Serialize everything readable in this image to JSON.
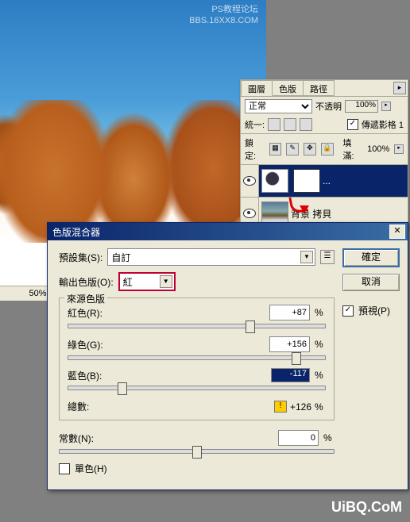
{
  "watermark": {
    "line1": "PS教程论坛",
    "line2": "BBS.16XX8.COM",
    "bottom": "UiBQ.CoM"
  },
  "zoom": "50%",
  "layers_panel": {
    "tabs": [
      "圖層",
      "色版",
      "路徑"
    ],
    "active_tab": 0,
    "blend_mode": "正常",
    "opacity_label": "不透明",
    "opacity_value": "100%",
    "unify_label": "統一:",
    "propagate_label": "傳遞影格 1",
    "lock_label": "鎖定:",
    "fill_label": "填滿:",
    "fill_value": "100%",
    "layers": [
      {
        "name": "...",
        "selected": true,
        "has_mask": true
      },
      {
        "name": "背景 拷貝",
        "selected": false
      }
    ]
  },
  "dialog": {
    "title": "色版混合器",
    "preset_label": "預設集(S):",
    "preset_value": "自訂",
    "output_label": "輸出色版(O):",
    "output_value": "紅",
    "ok": "確定",
    "cancel": "取消",
    "preview_label": "預視(P)",
    "source_group": "來源色版",
    "red_label": "紅色(R):",
    "red_value": "+87",
    "green_label": "綠色(G):",
    "green_value": "+156",
    "blue_label": "藍色(B):",
    "blue_value": "-117",
    "total_label": "總數:",
    "total_value": "+126",
    "constant_label": "常數(N):",
    "constant_value": "0",
    "mono_label": "單色(H)",
    "pct": "%"
  },
  "chart_data": {
    "type": "table",
    "title": "Channel Mixer — Red output channel",
    "series": [
      {
        "name": "紅色(R)",
        "value": 87
      },
      {
        "name": "綠色(G)",
        "value": 156
      },
      {
        "name": "藍色(B)",
        "value": -117
      },
      {
        "name": "總數",
        "value": 126
      },
      {
        "name": "常數(N)",
        "value": 0
      }
    ],
    "range": [
      -200,
      200
    ]
  }
}
